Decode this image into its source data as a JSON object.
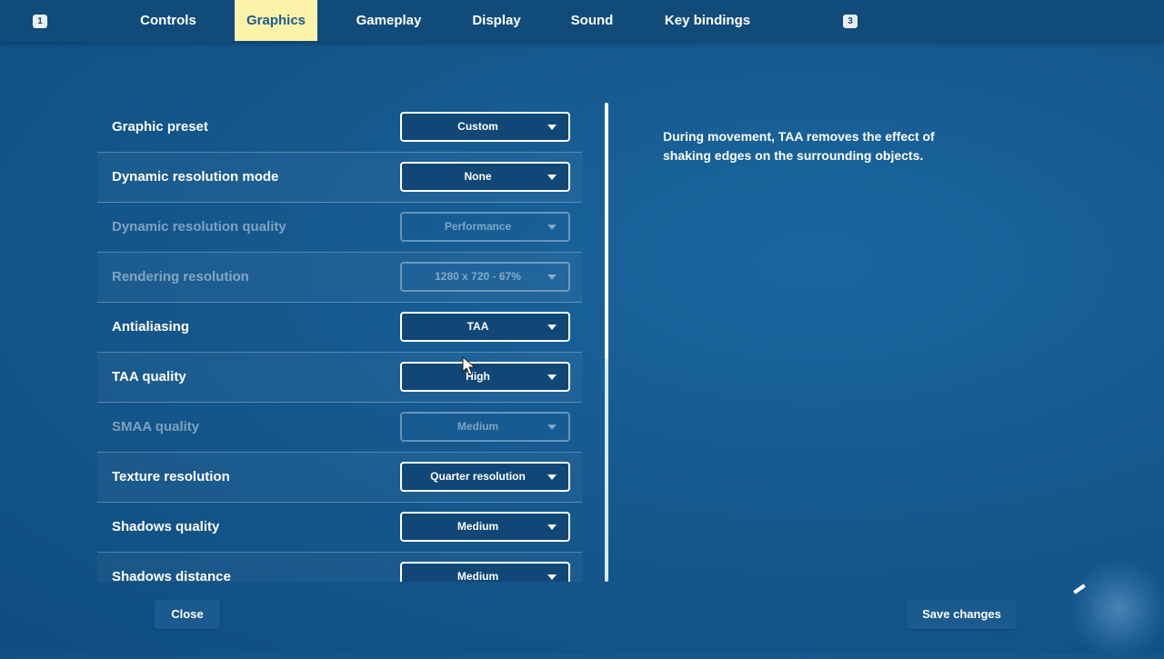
{
  "top_nav": {
    "left_key_hint": "1",
    "right_key_hint": "3",
    "tabs": [
      {
        "label": "Controls",
        "active": false
      },
      {
        "label": "Graphics",
        "active": true
      },
      {
        "label": "Gameplay",
        "active": false
      },
      {
        "label": "Display",
        "active": false
      },
      {
        "label": "Sound",
        "active": false
      },
      {
        "label": "Key bindings",
        "active": false
      }
    ]
  },
  "settings": [
    {
      "label": "Graphic preset",
      "value": "Custom",
      "enabled": true
    },
    {
      "label": "Dynamic resolution mode",
      "value": "None",
      "enabled": true
    },
    {
      "label": "Dynamic resolution quality",
      "value": "Performance",
      "enabled": false
    },
    {
      "label": "Rendering resolution",
      "value": "1280 x 720 - 67%",
      "enabled": false
    },
    {
      "label": "Antialiasing",
      "value": "TAA",
      "enabled": true
    },
    {
      "label": "TAA quality",
      "value": "High",
      "enabled": true
    },
    {
      "label": "SMAA quality",
      "value": "Medium",
      "enabled": false
    },
    {
      "label": "Texture resolution",
      "value": "Quarter resolution",
      "enabled": true
    },
    {
      "label": "Shadows quality",
      "value": "Medium",
      "enabled": true
    },
    {
      "label": "Shadows distance",
      "value": "Medium",
      "enabled": true
    }
  ],
  "description": "During movement, TAA removes the effect of shaking edges on the surrounding objects.",
  "footer": {
    "close_label": "Close",
    "save_label": "Save changes"
  },
  "colors": {
    "background": "#15598f",
    "top_bar": "#114b7a",
    "active_tab": "#fbf3a9",
    "active_tab_text": "#1d5a8c"
  },
  "icons": {
    "cursor": "mouse-pointer-icon",
    "edit": "pencil-icon"
  }
}
